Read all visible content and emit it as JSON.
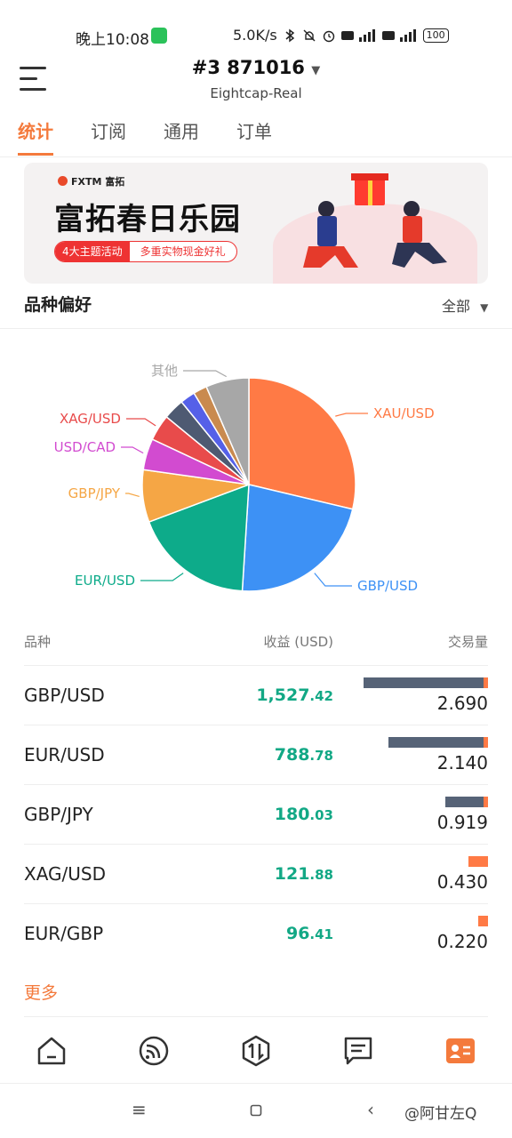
{
  "status_bar": {
    "time": "晚上10:08",
    "speed": "5.0K/s",
    "battery": "100"
  },
  "header": {
    "account": "#3  871016",
    "server": "Eightcap-Real"
  },
  "tabs": [
    {
      "label": "统计",
      "active": true
    },
    {
      "label": "订阅",
      "active": false
    },
    {
      "label": "通用",
      "active": false
    },
    {
      "label": "订单",
      "active": false
    }
  ],
  "banner": {
    "brand": "FXTM 富拓",
    "headline": "富拓春日乐园",
    "tag_left": "4大主题活动",
    "tag_right": "多重实物现金好礼"
  },
  "section": {
    "title": "品种偏好",
    "filter": "全部"
  },
  "chart_data": {
    "type": "pie",
    "slices": [
      {
        "label": "XAU/USD",
        "value": 29.0,
        "color": "#ff7a45"
      },
      {
        "label": "GBP/USD",
        "value": 22.5,
        "color": "#3d91f5"
      },
      {
        "label": "EUR/USD",
        "value": 18.5,
        "color": "#0dab8a"
      },
      {
        "label": "GBP/JPY",
        "value": 8.0,
        "color": "#f5a645"
      },
      {
        "label": "USD/CAD",
        "value": 4.8,
        "color": "#d24bd0"
      },
      {
        "label": "XAG/USD",
        "value": 4.0,
        "color": "#e84b4b"
      },
      {
        "label": "",
        "value": 3.2,
        "color": "#4e5a72"
      },
      {
        "label": "",
        "value": 2.3,
        "color": "#5560e8"
      },
      {
        "label": "",
        "value": 2.1,
        "color": "#c98a4f"
      },
      {
        "label": "其他",
        "value": 6.6,
        "color": "#a7a7a7"
      }
    ]
  },
  "table": {
    "headers": [
      "品种",
      "收益 (USD)",
      "交易量"
    ],
    "rows": [
      {
        "symbol": "GBP/USD",
        "profit_int": "1,527",
        "profit_dec": ".42",
        "volume": "2.690",
        "bar_fraction": 1.0
      },
      {
        "symbol": "EUR/USD",
        "profit_int": "788",
        "profit_dec": ".78",
        "volume": "2.140",
        "bar_fraction": 0.8
      },
      {
        "symbol": "GBP/JPY",
        "profit_int": "180",
        "profit_dec": ".03",
        "volume": "0.919",
        "bar_fraction": 0.34
      },
      {
        "symbol": "XAG/USD",
        "profit_int": "121",
        "profit_dec": ".88",
        "volume": "0.430",
        "bar_fraction": 0.16
      },
      {
        "symbol": "EUR/GBP",
        "profit_int": "96",
        "profit_dec": ".41",
        "volume": "0.220",
        "bar_fraction": 0.08
      }
    ],
    "more": "更多"
  },
  "colors": {
    "accent": "#f47a3c",
    "profit": "#12a885",
    "bar_main": "#566377",
    "bar_tip": "#ff7a45"
  },
  "watermark": "@阿甘左Q"
}
